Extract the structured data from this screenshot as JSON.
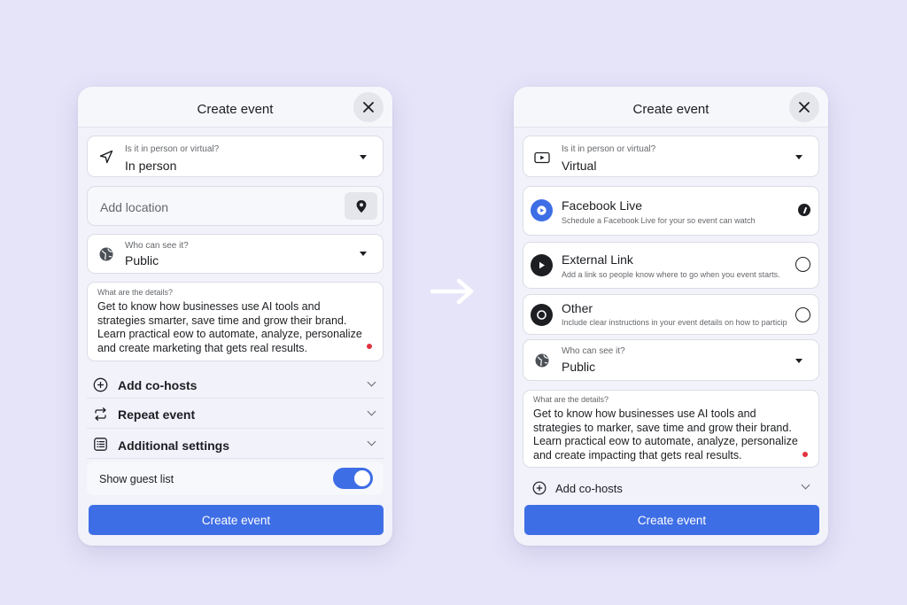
{
  "colors": {
    "background": "#e6e4f8",
    "panel": "#f1f2fa",
    "accent": "#3e6ee6",
    "text": "#1c1e21",
    "muted": "#65676b",
    "red_dot": "#e0323e"
  },
  "left_panel": {
    "title": "Create event",
    "close_icon": "close-icon",
    "event_type": {
      "label": "Is it in person or virtual?",
      "value": "In person",
      "icon": "location-arrow-icon"
    },
    "location": {
      "placeholder": "Add location",
      "icon": "map-pin-icon"
    },
    "privacy": {
      "label": "Who can see it?",
      "value": "Public",
      "icon": "globe-icon"
    },
    "details": {
      "label": "What are the details?",
      "text": "Get to know how businesses use AI tools and strategies smarter, save time and grow their brand. Learn practical eow to automate, analyze, personalize and create marketing that gets real results."
    },
    "rows": [
      {
        "label": "Add co-hosts",
        "icon": "plus-circle-icon"
      },
      {
        "label": "Repeat event",
        "icon": "repeat-icon"
      },
      {
        "label": "Additional settings",
        "icon": "list-icon"
      }
    ],
    "guest_list": {
      "label": "Show guest list",
      "enabled": true
    },
    "submit_label": "Create event"
  },
  "right_panel": {
    "title": "Create event",
    "close_icon": "close-icon",
    "event_type": {
      "label": "Is it in person or virtual?",
      "value": "Virtual",
      "icon": "video-icon"
    },
    "options": [
      {
        "title": "Facebook Live",
        "description": "Schedule a Facebook Live for your so event can watch",
        "icon": "facebook-live-icon",
        "selected": true
      },
      {
        "title": "External Link",
        "description": "Add a link so people know where to go when you event starts.",
        "icon": "play-icon",
        "selected": false
      },
      {
        "title": "Other",
        "description": "Include clear instructions in your event details on how to participate.",
        "icon": "circle-icon",
        "selected": false
      }
    ],
    "privacy": {
      "label": "Who can see it?",
      "value": "Public",
      "icon": "globe-icon"
    },
    "details": {
      "label": "What are the details?",
      "text": "Get to know how businesses use AI tools and strategies to marker, save time and grow their brand. Learn practical eow to automate, analyze, personalize and create impacting that gets real results."
    },
    "rows": [
      {
        "label": "Add co-hosts",
        "icon": "plus-circle-icon"
      }
    ],
    "submit_label": "Create event"
  },
  "transition_icon": "arrow-right-icon"
}
